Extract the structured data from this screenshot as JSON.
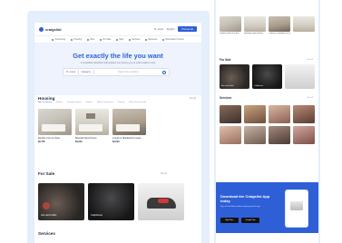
{
  "header": {
    "logo_text": "craigslist",
    "location": "St. Louis",
    "language": "English",
    "post_button": "Post an Ad"
  },
  "categories": [
    "Community",
    "Housing",
    "Jobs",
    "For Sale",
    "Gigs",
    "Services",
    "Resumes",
    "Discussion Forums"
  ],
  "hero": {
    "title": "Get exactly the life you want",
    "subtitle": "A simplified classified marketplace connecting you to what matters most",
    "location_select": "St. Louis",
    "category_select": "Category",
    "search_placeholder": "Search for anything"
  },
  "housing": {
    "title": "Housing",
    "see_all": "See all",
    "filters": [
      "Apts & Housing",
      "Rooms",
      "Vacation rentals",
      "Sublets",
      "Office/Commercial",
      "Parking",
      "Real estate for sale"
    ],
    "listings": [
      {
        "caption": "Double room to share",
        "price": "$2,750"
      },
      {
        "caption": "Bespoke Mew House",
        "price": "$3,000"
      },
      {
        "caption": "2 beds in Shadwell for swap",
        "price": "$2,000"
      }
    ]
  },
  "for_sale": {
    "title": "For Sale",
    "see_all": "See all",
    "items": [
      "Arts and Crafts",
      "Cellphones",
      "Shoes"
    ]
  },
  "services": {
    "title": "Services"
  },
  "right": {
    "for_sale_title": "For Sale",
    "for_sale_items": [
      "Arts and Crafts",
      "Cellphones",
      "Shoes"
    ],
    "services_title": "Services",
    "see_all": "See all",
    "promo_title": "Download the Craigslist App today",
    "promo_text": "Buy, sell and find just about anything with the app",
    "app_store": "App Store",
    "google_play": "Google Play"
  },
  "colors": {
    "brand_blue": "#2f5fd7",
    "panel_bg": "#e4eefc"
  }
}
